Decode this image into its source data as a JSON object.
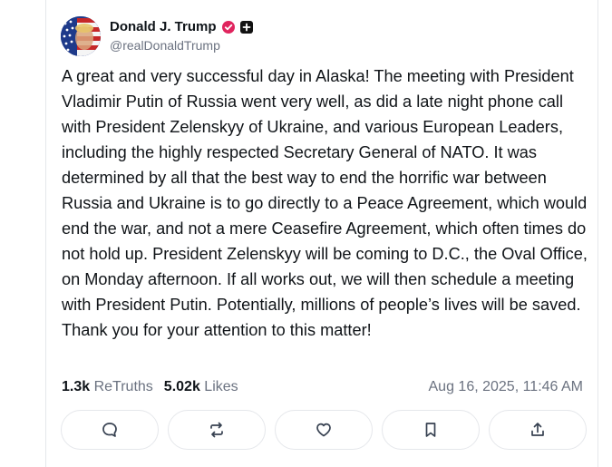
{
  "author": {
    "name": "Donald J. Trump",
    "handle": "@realDonaldTrump",
    "verified_color": "#e0245e"
  },
  "post": {
    "text": "A great and very successful day in Alaska! The meeting with President Vladimir Putin of Russia went very well, as did a late night phone call with President Zelenskyy of Ukraine, and various European Leaders, including the highly respected Secretary General of NATO. It was determined by all that the best way to end the horrific war between Russia and Ukraine is to go directly to a Peace Agreement, which would end the war, and not a mere Ceasefire Agreement, which often times do not hold up. President Zelenskyy will be coming to D.C., the Oval Office, on Monday afternoon. If all works out, we will then schedule a meeting with President Putin. Potentially, millions of people’s lives will be saved. Thank you for your attention to this matter!",
    "retruths_count": "1.3k",
    "retruths_label": "ReTruths",
    "likes_count": "5.02k",
    "likes_label": "Likes",
    "timestamp": "Aug 16, 2025, 11:46 AM"
  },
  "actions": [
    {
      "icon": "reply-icon"
    },
    {
      "icon": "retruth-icon"
    },
    {
      "icon": "like-heart-icon"
    },
    {
      "icon": "bookmark-icon"
    },
    {
      "icon": "share-upload-icon"
    }
  ]
}
